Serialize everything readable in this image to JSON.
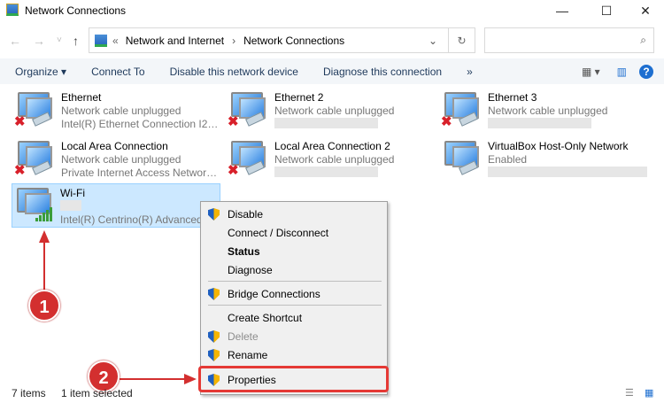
{
  "window": {
    "title": "Network Connections",
    "minimize": "—",
    "maximize": "☐",
    "close": "✕"
  },
  "nav": {
    "back": "←",
    "forward": "→",
    "recent": "˅",
    "up": "↑"
  },
  "address": {
    "prefix": "«",
    "crumbs": [
      "Network and Internet",
      "Network Connections"
    ],
    "sep": "›",
    "dropdown": "⌄",
    "refresh": "↻"
  },
  "search": {
    "placeholder": "",
    "icon": "⌕"
  },
  "toolbar": {
    "organize": "Organize ▾",
    "connect_to": "Connect To",
    "disable": "Disable this network device",
    "diagnose": "Diagnose this connection",
    "more": "»",
    "view": "▦ ▾",
    "preview": "▥",
    "help": "?"
  },
  "connections": [
    {
      "name": "Ethernet",
      "status": "Network cable unplugged",
      "device": "Intel(R) Ethernet Connection I217...",
      "state": "disconnected"
    },
    {
      "name": "Ethernet 2",
      "status": "Network cable unplugged",
      "device": "",
      "state": "disconnected"
    },
    {
      "name": "Ethernet 3",
      "status": "Network cable unplugged",
      "device": "",
      "state": "disconnected"
    },
    {
      "name": "Local Area Connection",
      "status": "Network cable unplugged",
      "device": "Private Internet Access Network A...",
      "state": "disconnected"
    },
    {
      "name": "Local Area Connection 2",
      "status": "Network cable unplugged",
      "device": "",
      "state": "disconnected"
    },
    {
      "name": "VirtualBox Host-Only Network",
      "status": "Enabled",
      "device": "",
      "state": "enabled"
    },
    {
      "name": "Wi-Fi",
      "status": "",
      "device": "Intel(R) Centrino(R) Advanced-N",
      "state": "wifi",
      "selected": true
    }
  ],
  "menu": [
    {
      "label": "Disable",
      "shield": true
    },
    {
      "label": "Connect / Disconnect"
    },
    {
      "label": "Status",
      "bold": true
    },
    {
      "label": "Diagnose"
    },
    {
      "label": "Bridge Connections",
      "shield": true
    },
    {
      "label": "Create Shortcut"
    },
    {
      "label": "Delete",
      "shield": true,
      "disabled": true
    },
    {
      "label": "Rename",
      "shield": true
    },
    {
      "label": "Properties",
      "shield": true
    }
  ],
  "statusbar": {
    "count": "7 items",
    "selected": "1 item selected"
  },
  "annotations": {
    "step1": "1",
    "step2": "2",
    "color": "#d32f2f"
  }
}
